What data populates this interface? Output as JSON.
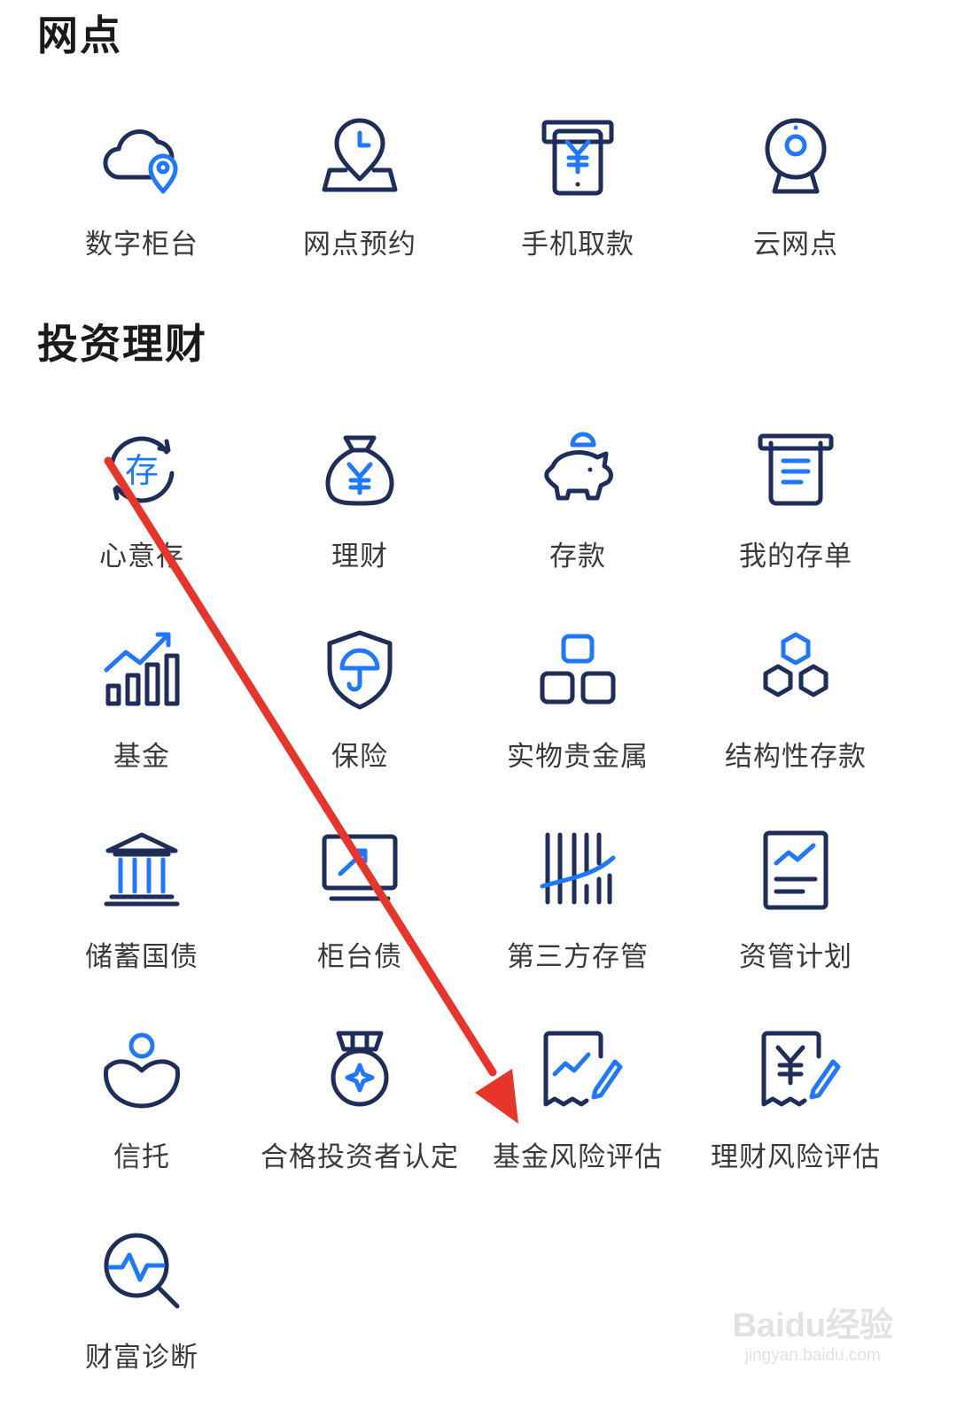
{
  "sections": {
    "network": {
      "title": "网点",
      "items": [
        {
          "label": "数字柜台",
          "icon": "cloud-location-icon"
        },
        {
          "label": "网点预约",
          "icon": "location-clock-icon"
        },
        {
          "label": "手机取款",
          "icon": "atm-cash-icon"
        },
        {
          "label": "云网点",
          "icon": "webcam-icon"
        }
      ]
    },
    "invest": {
      "title": "投资理财",
      "items": [
        {
          "label": "心意存",
          "icon": "cycle-deposit-icon",
          "glyph": "存"
        },
        {
          "label": "理财",
          "icon": "money-bag-icon"
        },
        {
          "label": "存款",
          "icon": "piggy-bank-icon"
        },
        {
          "label": "我的存单",
          "icon": "receipt-icon"
        },
        {
          "label": "基金",
          "icon": "growth-chart-icon"
        },
        {
          "label": "保险",
          "icon": "shield-umbrella-icon"
        },
        {
          "label": "实物贵金属",
          "icon": "gold-bars-icon"
        },
        {
          "label": "结构性存款",
          "icon": "hexagons-icon"
        },
        {
          "label": "储蓄国债",
          "icon": "bank-building-icon"
        },
        {
          "label": "柜台债",
          "icon": "monitor-trend-icon"
        },
        {
          "label": "第三方存管",
          "icon": "barcode-icon"
        },
        {
          "label": "资管计划",
          "icon": "document-chart-icon"
        },
        {
          "label": "信托",
          "icon": "person-hands-icon"
        },
        {
          "label": "合格投资者认定",
          "icon": "medal-icon"
        },
        {
          "label": "基金风险评估",
          "icon": "chart-pen-icon"
        },
        {
          "label": "理财风险评估",
          "icon": "yen-pen-icon"
        },
        {
          "label": "财富诊断",
          "icon": "magnifier-pulse-icon"
        }
      ]
    }
  },
  "watermark": {
    "main": "Baidu经验",
    "sub": "jingyan.baidu.com"
  },
  "colors": {
    "icon_dark": "#1f2d5a",
    "icon_accent": "#1f78ff",
    "arrow": "#e8352b",
    "label": "#3a3a3a"
  }
}
